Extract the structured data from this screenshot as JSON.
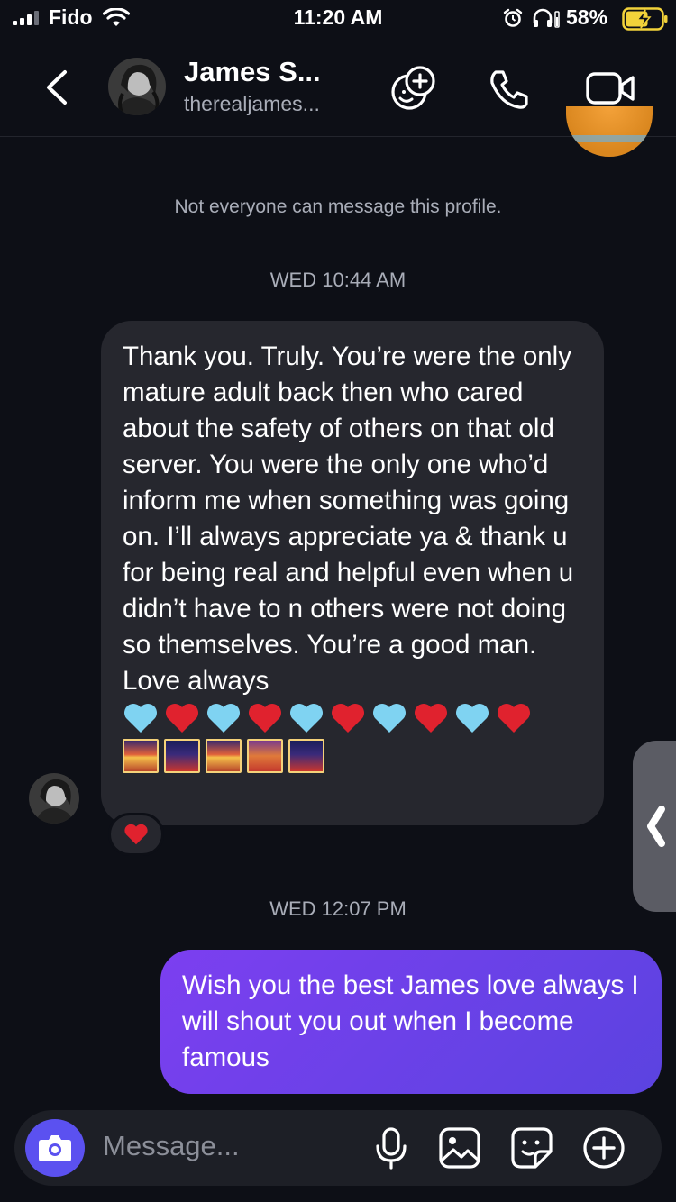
{
  "status_bar": {
    "carrier": "Fido",
    "time": "11:20 AM",
    "battery": "58%"
  },
  "header": {
    "name": "James S...",
    "handle": "therealjames..."
  },
  "conversation": {
    "notice": "Not everyone can message this profile.",
    "timestamp_1": "WED 10:44 AM",
    "incoming_message": "Thank you. Truly. You’re were the only mature adult back then who cared about the safety of others on that old server. You were the only one who’d inform me when something was going on. I’ll always appreciate ya & thank u for being real and helpful even when u didn’t have to n others were not doing so themselves. You’re a good man. Love always",
    "incoming_emoji_hearts": [
      "light-blue-heart",
      "red-heart",
      "light-blue-heart",
      "red-heart",
      "light-blue-heart",
      "red-heart",
      "light-blue-heart",
      "red-heart",
      "light-blue-heart",
      "red-heart"
    ],
    "incoming_emoji_tiles": [
      "sunset-icon",
      "city-night-icon",
      "sunset-icon",
      "city-dusk-icon",
      "city-night-icon"
    ],
    "reaction": "red-heart",
    "timestamp_2": "WED 12:07 PM",
    "outgoing_message": "Wish you the best James love always I will shout you out when I become famous"
  },
  "composer": {
    "placeholder": "Message..."
  },
  "colors": {
    "background": "#0d0f16",
    "incoming_bubble": "#26272e",
    "outgoing_bubble_start": "#7c3ff0",
    "outgoing_bubble_end": "#5b43e0",
    "camera_button": "#5b51f0"
  }
}
